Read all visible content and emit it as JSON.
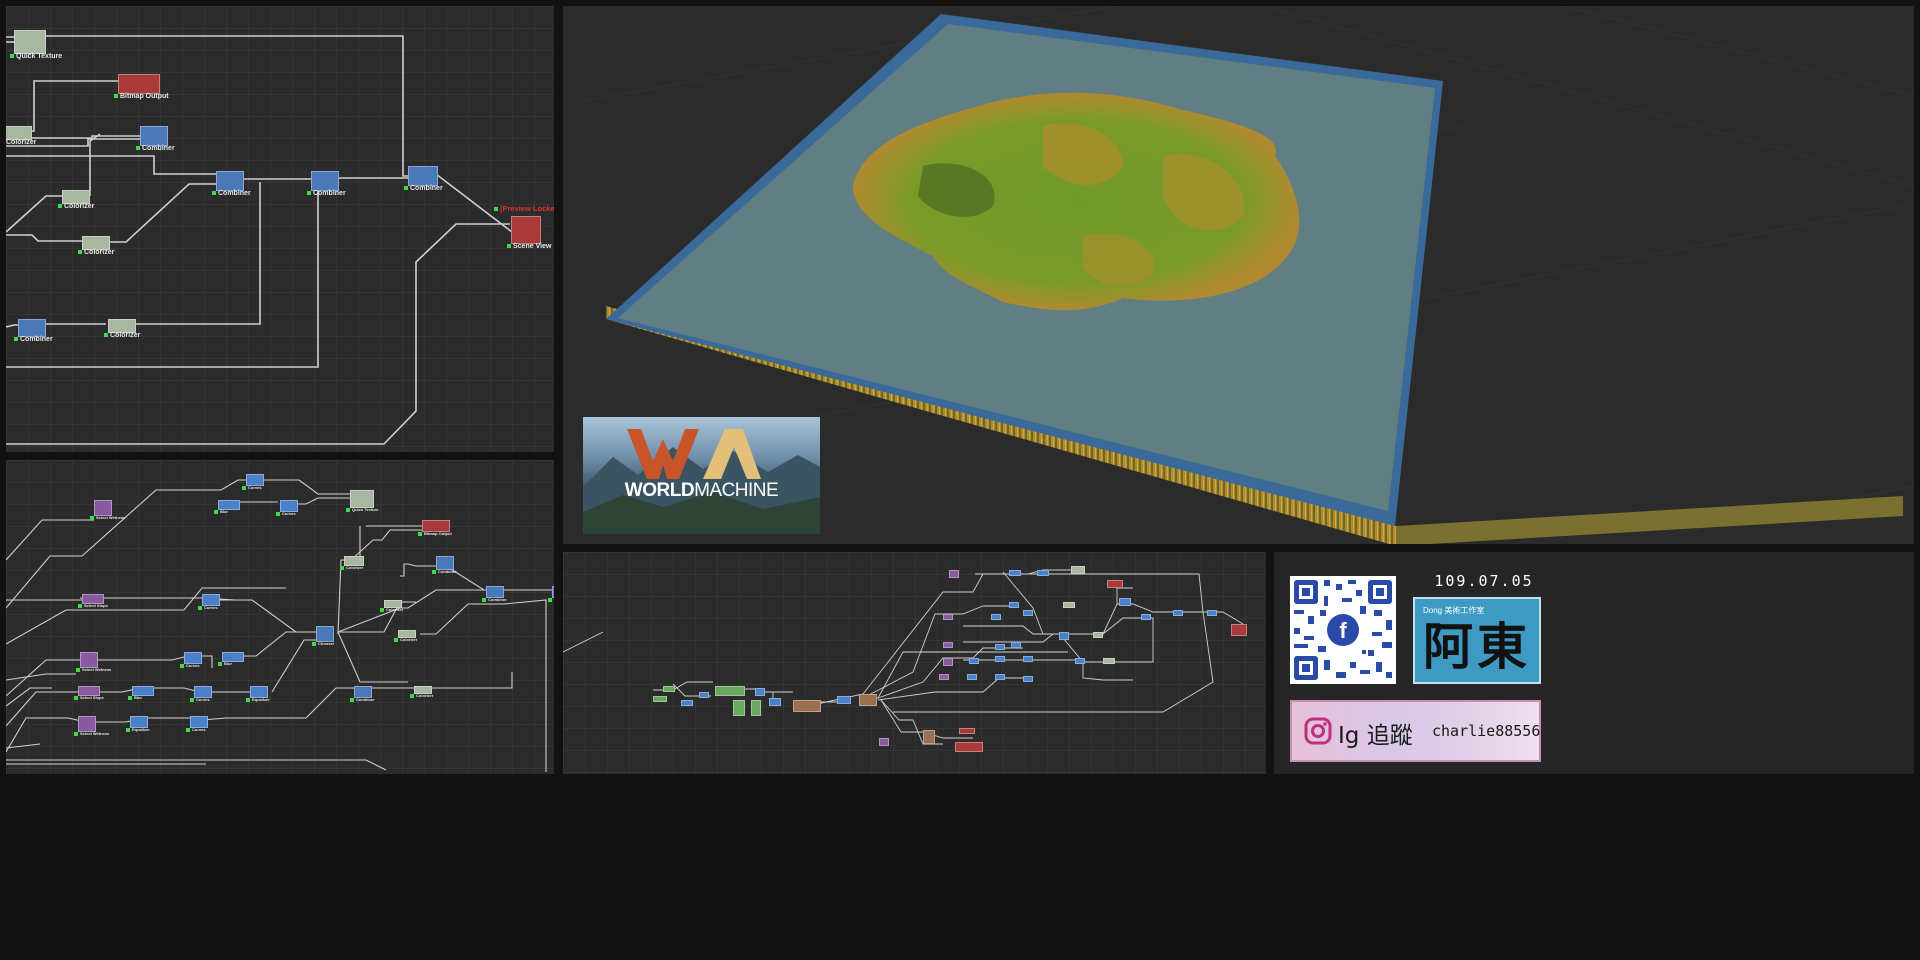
{
  "colors": {
    "background": "#121212",
    "graph_bg": "#2b2b2b",
    "node_colorizer": "#a8b8a0",
    "node_combiner": "#4a78b8",
    "node_output": "#a83a3a",
    "node_select": "#8a5aa0",
    "node_curves": "#4a80c8",
    "node_generator": "#6aa860",
    "node_brown": "#9a7050",
    "locked_text": "#e03030"
  },
  "graph_top": {
    "nodes": [
      {
        "label": "Quick Texture",
        "type": "colorizer",
        "icon": "quick-texture-icon"
      },
      {
        "label": "Bitmap Output",
        "type": "output",
        "icon": "bitmap-output-icon"
      },
      {
        "label": "Colorizer",
        "type": "colorizer",
        "icon": "colorizer-icon"
      },
      {
        "label": "Combiner",
        "type": "combiner",
        "icon": "combiner-icon"
      },
      {
        "label": "Colorizer",
        "type": "colorizer",
        "icon": "colorizer-icon"
      },
      {
        "label": "Combiner",
        "type": "combiner",
        "icon": "combiner-icon"
      },
      {
        "label": "Combiner",
        "type": "combiner",
        "icon": "combiner-icon"
      },
      {
        "label": "Combiner",
        "type": "combiner",
        "icon": "combiner-icon"
      },
      {
        "label": "Colorizer",
        "type": "colorizer",
        "icon": "colorizer-icon"
      },
      {
        "label": "Scene View",
        "type": "output",
        "icon": "scene-view-icon"
      },
      {
        "label": "Combiner",
        "type": "combiner",
        "icon": "combiner-icon"
      },
      {
        "label": "Colorizer",
        "type": "colorizer",
        "icon": "colorizer-icon"
      }
    ],
    "locked_label": "(Preview Locked)"
  },
  "graph_bottom_left": {
    "nodes": [
      {
        "label": "Curves",
        "type": "curves"
      },
      {
        "label": "Select Wetness",
        "type": "select"
      },
      {
        "label": "Blur",
        "type": "curves"
      },
      {
        "label": "Curves",
        "type": "curves"
      },
      {
        "label": "Quick Texture",
        "type": "colorizer"
      },
      {
        "label": "Bitmap Output",
        "type": "output"
      },
      {
        "label": "Colorizer",
        "type": "colorizer"
      },
      {
        "label": "Combiner",
        "type": "combiner"
      },
      {
        "label": "Select Slope",
        "type": "select"
      },
      {
        "label": "Curves",
        "type": "curves"
      },
      {
        "label": "Colorizer",
        "type": "colorizer"
      },
      {
        "label": "Combiner",
        "type": "combiner"
      },
      {
        "label": "Combiner",
        "type": "combiner"
      },
      {
        "label": "Combiner",
        "type": "combiner"
      },
      {
        "label": "Chooser",
        "type": "combiner"
      },
      {
        "label": "Colorizer",
        "type": "colorizer"
      },
      {
        "label": "Select Wetness",
        "type": "select"
      },
      {
        "label": "Curves",
        "type": "curves"
      },
      {
        "label": "Blur",
        "type": "curves"
      },
      {
        "label": "Select Slope",
        "type": "select"
      },
      {
        "label": "Blur",
        "type": "curves"
      },
      {
        "label": "Curves",
        "type": "curves"
      },
      {
        "label": "Equalizer",
        "type": "curves"
      },
      {
        "label": "Combiner",
        "type": "combiner"
      },
      {
        "label": "Colorizer",
        "type": "colorizer"
      },
      {
        "label": "Select Wetness",
        "type": "select"
      },
      {
        "label": "Equalizer",
        "type": "curves"
      },
      {
        "label": "Curves",
        "type": "curves"
      }
    ]
  },
  "viewport": {
    "logo": {
      "title_bold": "WORLD",
      "title_light": "MACHINE"
    }
  },
  "social": {
    "date": "109.07.05",
    "facebook_icon": "facebook-icon",
    "studio_small_text": "Dong 美術工作室",
    "studio_big_text": "阿東",
    "instagram_icon": "instagram-icon",
    "instagram_prefix": "Ig 追蹤",
    "instagram_handle": "charlie88556"
  }
}
